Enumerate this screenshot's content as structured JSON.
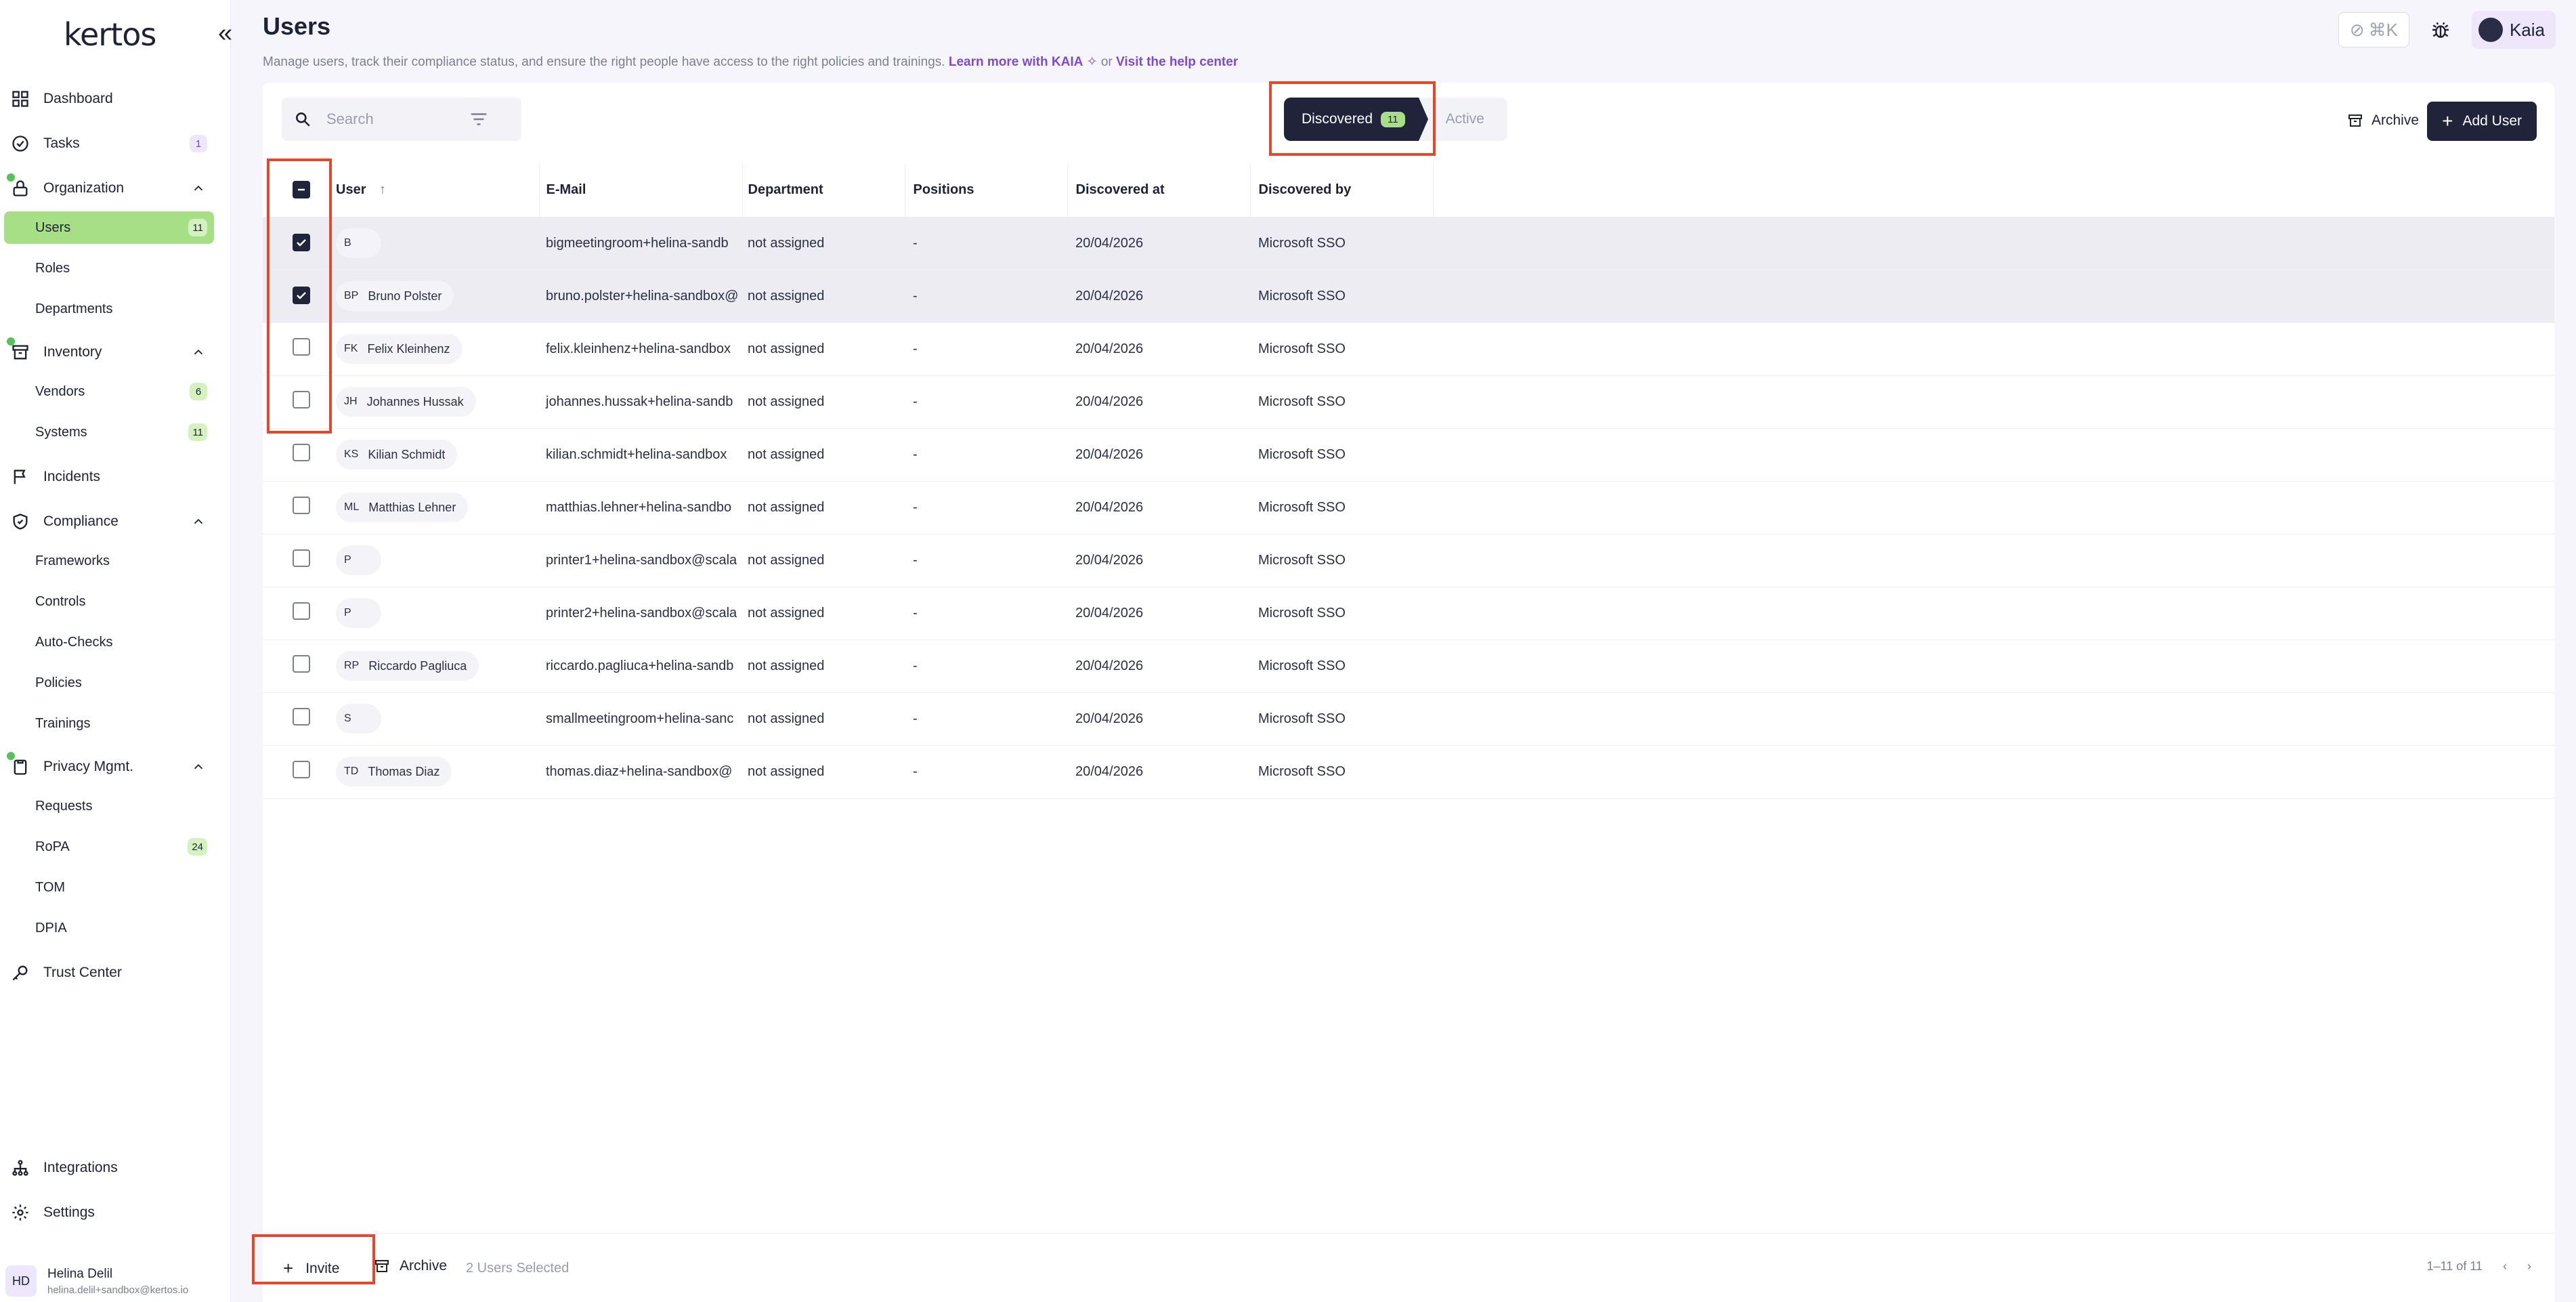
{
  "sidebar": {
    "logo": "kertos",
    "items": [
      {
        "label": "Dashboard"
      },
      {
        "label": "Tasks",
        "badge": "1"
      },
      {
        "label": "Organization"
      },
      {
        "label": "Users",
        "badge": "11"
      },
      {
        "label": "Roles"
      },
      {
        "label": "Departments"
      },
      {
        "label": "Inventory"
      },
      {
        "label": "Vendors",
        "badge": "6"
      },
      {
        "label": "Systems",
        "badge": "11"
      },
      {
        "label": "Incidents"
      },
      {
        "label": "Compliance"
      },
      {
        "label": "Frameworks"
      },
      {
        "label": "Controls"
      },
      {
        "label": "Auto-Checks"
      },
      {
        "label": "Policies"
      },
      {
        "label": "Trainings"
      },
      {
        "label": "Privacy Mgmt."
      },
      {
        "label": "Requests"
      },
      {
        "label": "RoPA",
        "badge": "24"
      },
      {
        "label": "TOM"
      },
      {
        "label": "DPIA"
      },
      {
        "label": "Trust Center"
      },
      {
        "label": "Integrations"
      },
      {
        "label": "Settings"
      }
    ],
    "profile": {
      "initials": "HD",
      "name": "Helina Delil",
      "email": "helina.delil+sandbox@kertos.io"
    }
  },
  "header": {
    "title": "Users",
    "subtitle": "Manage users, track their compliance status, and ensure the right people have access to the right policies and trainings.",
    "link_kaia": "Learn more with KAIA",
    "or": "or",
    "link_help": "Visit the help center",
    "shortcut": "⌘K",
    "assistant": "Kaia"
  },
  "toolbar": {
    "search_placeholder": "Search",
    "tab_discovered": "Discovered",
    "tab_discovered_count": "11",
    "tab_active": "Active",
    "archive": "Archive",
    "add_user": "Add User"
  },
  "table": {
    "headers": [
      "User",
      "E-Mail",
      "Department",
      "Positions",
      "Discovered at",
      "Discovered by"
    ],
    "rows": [
      {
        "initials": "B",
        "name": "",
        "email": "bigmeetingroom+helina-sandb",
        "dept": "not assigned",
        "pos": "-",
        "date": "20/04/2026",
        "by": "Microsoft SSO",
        "checked": true
      },
      {
        "initials": "BP",
        "name": "Bruno Polster",
        "email": "bruno.polster+helina-sandbox@",
        "dept": "not assigned",
        "pos": "-",
        "date": "20/04/2026",
        "by": "Microsoft SSO",
        "checked": true
      },
      {
        "initials": "FK",
        "name": "Felix Kleinhenz",
        "email": "felix.kleinhenz+helina-sandbox",
        "dept": "not assigned",
        "pos": "-",
        "date": "20/04/2026",
        "by": "Microsoft SSO",
        "checked": false
      },
      {
        "initials": "JH",
        "name": "Johannes Hussak",
        "email": "johannes.hussak+helina-sandb",
        "dept": "not assigned",
        "pos": "-",
        "date": "20/04/2026",
        "by": "Microsoft SSO",
        "checked": false
      },
      {
        "initials": "KS",
        "name": "Kilian Schmidt",
        "email": "kilian.schmidt+helina-sandbox",
        "dept": "not assigned",
        "pos": "-",
        "date": "20/04/2026",
        "by": "Microsoft SSO",
        "checked": false
      },
      {
        "initials": "ML",
        "name": "Matthias Lehner",
        "email": "matthias.lehner+helina-sandbo",
        "dept": "not assigned",
        "pos": "-",
        "date": "20/04/2026",
        "by": "Microsoft SSO",
        "checked": false
      },
      {
        "initials": "P",
        "name": "",
        "email": "printer1+helina-sandbox@scala",
        "dept": "not assigned",
        "pos": "-",
        "date": "20/04/2026",
        "by": "Microsoft SSO",
        "checked": false
      },
      {
        "initials": "P",
        "name": "",
        "email": "printer2+helina-sandbox@scala",
        "dept": "not assigned",
        "pos": "-",
        "date": "20/04/2026",
        "by": "Microsoft SSO",
        "checked": false
      },
      {
        "initials": "RP",
        "name": "Riccardo Pagliuca",
        "email": "riccardo.pagliuca+helina-sandb",
        "dept": "not assigned",
        "pos": "-",
        "date": "20/04/2026",
        "by": "Microsoft SSO",
        "checked": false
      },
      {
        "initials": "S",
        "name": "",
        "email": "smallmeetingroom+helina-sanc",
        "dept": "not assigned",
        "pos": "-",
        "date": "20/04/2026",
        "by": "Microsoft SSO",
        "checked": false
      },
      {
        "initials": "TD",
        "name": "Thomas Diaz",
        "email": "thomas.diaz+helina-sandbox@",
        "dept": "not assigned",
        "pos": "-",
        "date": "20/04/2026",
        "by": "Microsoft SSO",
        "checked": false
      }
    ]
  },
  "footer": {
    "invite": "Invite",
    "archive": "Archive",
    "selected": "2 Users Selected",
    "range": "1–11 of 11"
  },
  "colors": {
    "accent": "#a7df86",
    "dark": "#20233a",
    "link": "#7b4bd1",
    "highlight": "#e2492b"
  }
}
